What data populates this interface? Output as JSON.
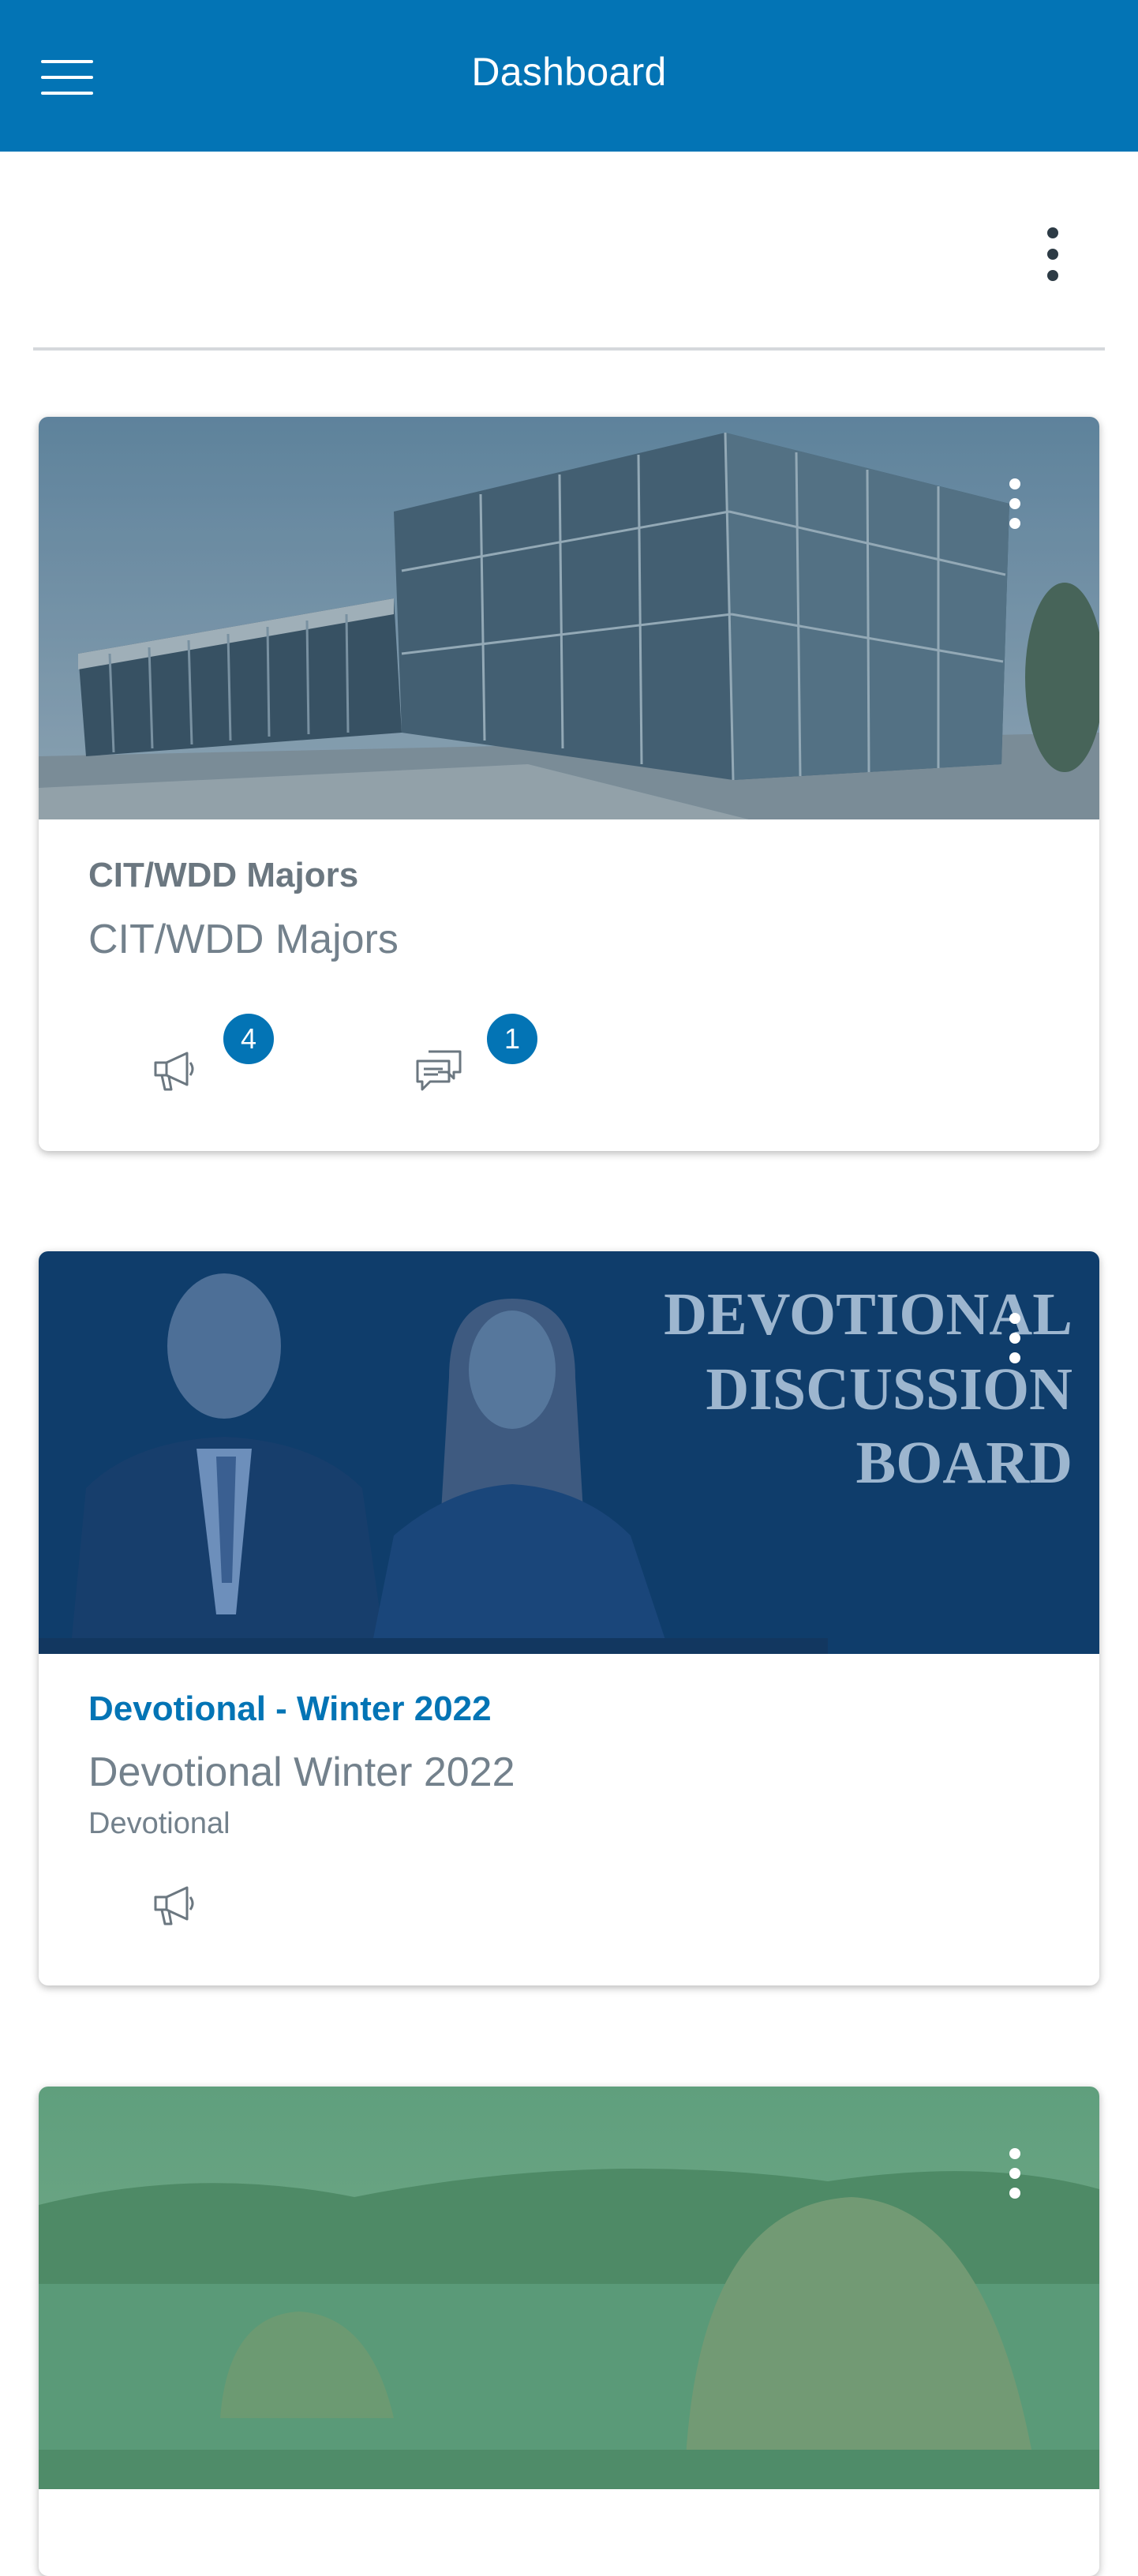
{
  "header": {
    "title": "Dashboard",
    "background": "#0374B5"
  },
  "courses": [
    {
      "title": "CIT/WDD Majors",
      "title_color": "#6B7780",
      "name": "CIT/WDD Majors",
      "term": "",
      "image": "building-photo",
      "announcements_badge": "4",
      "discussions_badge": "1"
    },
    {
      "title": "Devotional - Winter 2022",
      "title_color": "#0374B5",
      "name": "Devotional Winter 2022",
      "term": "Devotional",
      "image": "devotional-photo",
      "image_text": [
        "DEVOTIONAL",
        "DISCUSSION",
        "BOARD"
      ]
    },
    {
      "image": "haystacks-painting"
    }
  ],
  "icons": [
    "hamburger-menu-icon",
    "kebab-menu-icon",
    "announcement-icon",
    "discussion-icon"
  ]
}
